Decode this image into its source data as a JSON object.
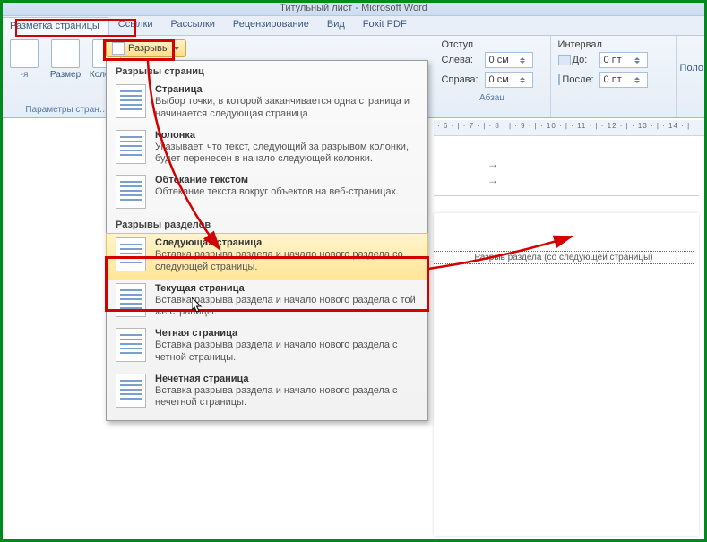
{
  "window": {
    "title": "Титульный лист - Microsoft Word"
  },
  "tabs": [
    "Разметка страницы",
    "Ссылки",
    "Рассылки",
    "Рецензирование",
    "Вид",
    "Foxit PDF"
  ],
  "ribbon": {
    "left_buttons": [
      "-я",
      "Размер",
      "Колонки"
    ],
    "left_group_label": "Параметры стран…",
    "breaks_button": "Разрывы",
    "indent": {
      "title": "Отступ",
      "left_label": "Слева:",
      "left_value": "0 см",
      "right_label": "Справа:",
      "right_value": "0 см"
    },
    "spacing": {
      "title": "Интервал",
      "before_label": "До:",
      "before_value": "0 пт",
      "after_label": "После:",
      "after_value": "0 пт"
    },
    "para_label": "Абзац",
    "right_cut": "Поло"
  },
  "menu": {
    "section1": "Разрывы страниц",
    "items1": [
      {
        "title": "Страница",
        "desc": "Выбор точки, в которой заканчивается одна страница и начинается следующая страница."
      },
      {
        "title": "Колонка",
        "desc": "Указывает, что текст, следующий за разрывом колонки, будет перенесен в начало следующей колонки."
      },
      {
        "title": "Обтекание текстом",
        "desc": "Обтекание текста вокруг объектов на веб-страницах."
      }
    ],
    "section2": "Разрывы разделов",
    "items2": [
      {
        "title": "Следующая страница",
        "desc": "Вставка разрыва раздела и начало нового раздела со следующей страницы."
      },
      {
        "title": "Текущая страница",
        "desc": "Вставка разрыва раздела и начало нового раздела с той же страницы."
      },
      {
        "title": "Четная страница",
        "desc": "Вставка разрыва раздела и начало нового раздела с четной страницы."
      },
      {
        "title": "Нечетная страница",
        "desc": "Вставка разрыва раздела и начало нового раздела с нечетной страницы."
      }
    ]
  },
  "ruler_marks": "· 6 · | · 7 · | · 8 · | · 9 · | · 10 · | · 11 · | · 12 · | · 13 · | · 14 · |",
  "section_break_label": "Разрыв раздела (со следующей страницы)"
}
